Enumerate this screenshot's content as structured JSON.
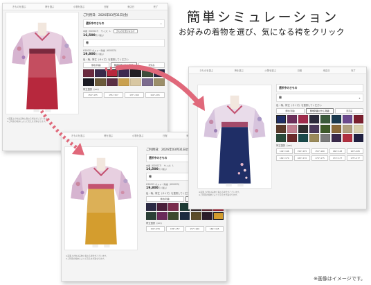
{
  "headline": "簡単シミュレーション",
  "subline": "お好みの着物を選び、気になる袴をクリック",
  "caption": "※画像はイメージです。",
  "nav_items": [
    "きものを選ぶ",
    "袴を選ぶ",
    "小物を選ぶ",
    "日程",
    "来店日",
    "完了"
  ],
  "panel": {
    "date": "ご利用日：2026年03月31日(金)",
    "kimono_label": "選択中のきもの",
    "kimono_meta": "中振（K20027）　サイズ：L",
    "kimono_button": "きものを選びなおす",
    "kimono_price": "16,500",
    "hakama_label": "袴",
    "hakama_meta": "H20025 ボルドー刺繍（H20025）",
    "hakama_price": "19,800",
    "tax": "円（税込）",
    "color_prompt": "色・柄、袴丈（サイズ）を選択してください",
    "tabs": [
      "無地(刺繍)",
      "無地刺繍(ぼかし刺繍)",
      "限定品"
    ],
    "size_label": "袴丈選択（cm）",
    "sizes_small": [
      "150〜155",
      "155〜157",
      "157〜160",
      "160〜165"
    ],
    "sizes_large": [
      "142〜146",
      "150〜155",
      "155〜160",
      "160〜163",
      "163〜165",
      "162〜170",
      "165〜170",
      "170〜175",
      "172〜177",
      "175〜177"
    ],
    "notes": [
      "※画面上の色は実物と異なる場合がございます。",
      "※ご利用の端末によって見え方が異なります。"
    ]
  },
  "colors": {
    "swatches_1": [
      "#6a2a3e",
      "#3a2a4a",
      "#b7283d",
      "#3d2950",
      "#221f24",
      "#3e4d3b",
      "#2c2a46",
      "#1a1a22",
      "#6b5a3a",
      "#5a2f44",
      "#c9a04f",
      "#d8c7a2",
      "#7c6b8e",
      "#9c8f6a"
    ],
    "swatches_2": [
      "#2b2a44",
      "#4a1f3a",
      "#7b2c4d",
      "#1d3b34",
      "#3a2a2d",
      "#6b2230",
      "#b21f33",
      "#2a3f36",
      "#6a2a5a",
      "#3c4a2d",
      "#1c2b3f",
      "#5d4e2b",
      "#2b1d2a",
      "#d49d2e"
    ],
    "swatches_3": [
      "#1f2e66",
      "#6b2f5a",
      "#a02c4c",
      "#2a2a3a",
      "#3a5a3c",
      "#1b3a4f",
      "#6b4a8e",
      "#7a1f2e",
      "#5a3a2a",
      "#c08090",
      "#2e2e2e",
      "#4a3a5a",
      "#3e5a2a",
      "#8a6a3a",
      "#b0a080",
      "#d8cfae",
      "#2a4a3a",
      "#6a2a2a",
      "#1a4a4a",
      "#9a8a5a",
      "#7a7a7a",
      "#3a2a4a",
      "#b03040",
      "#202040"
    ],
    "hakama_1": "#b7283d",
    "hakama_2": "#d49d2e",
    "hakama_3": "#1f2e66",
    "arrow": "#e0687a"
  }
}
